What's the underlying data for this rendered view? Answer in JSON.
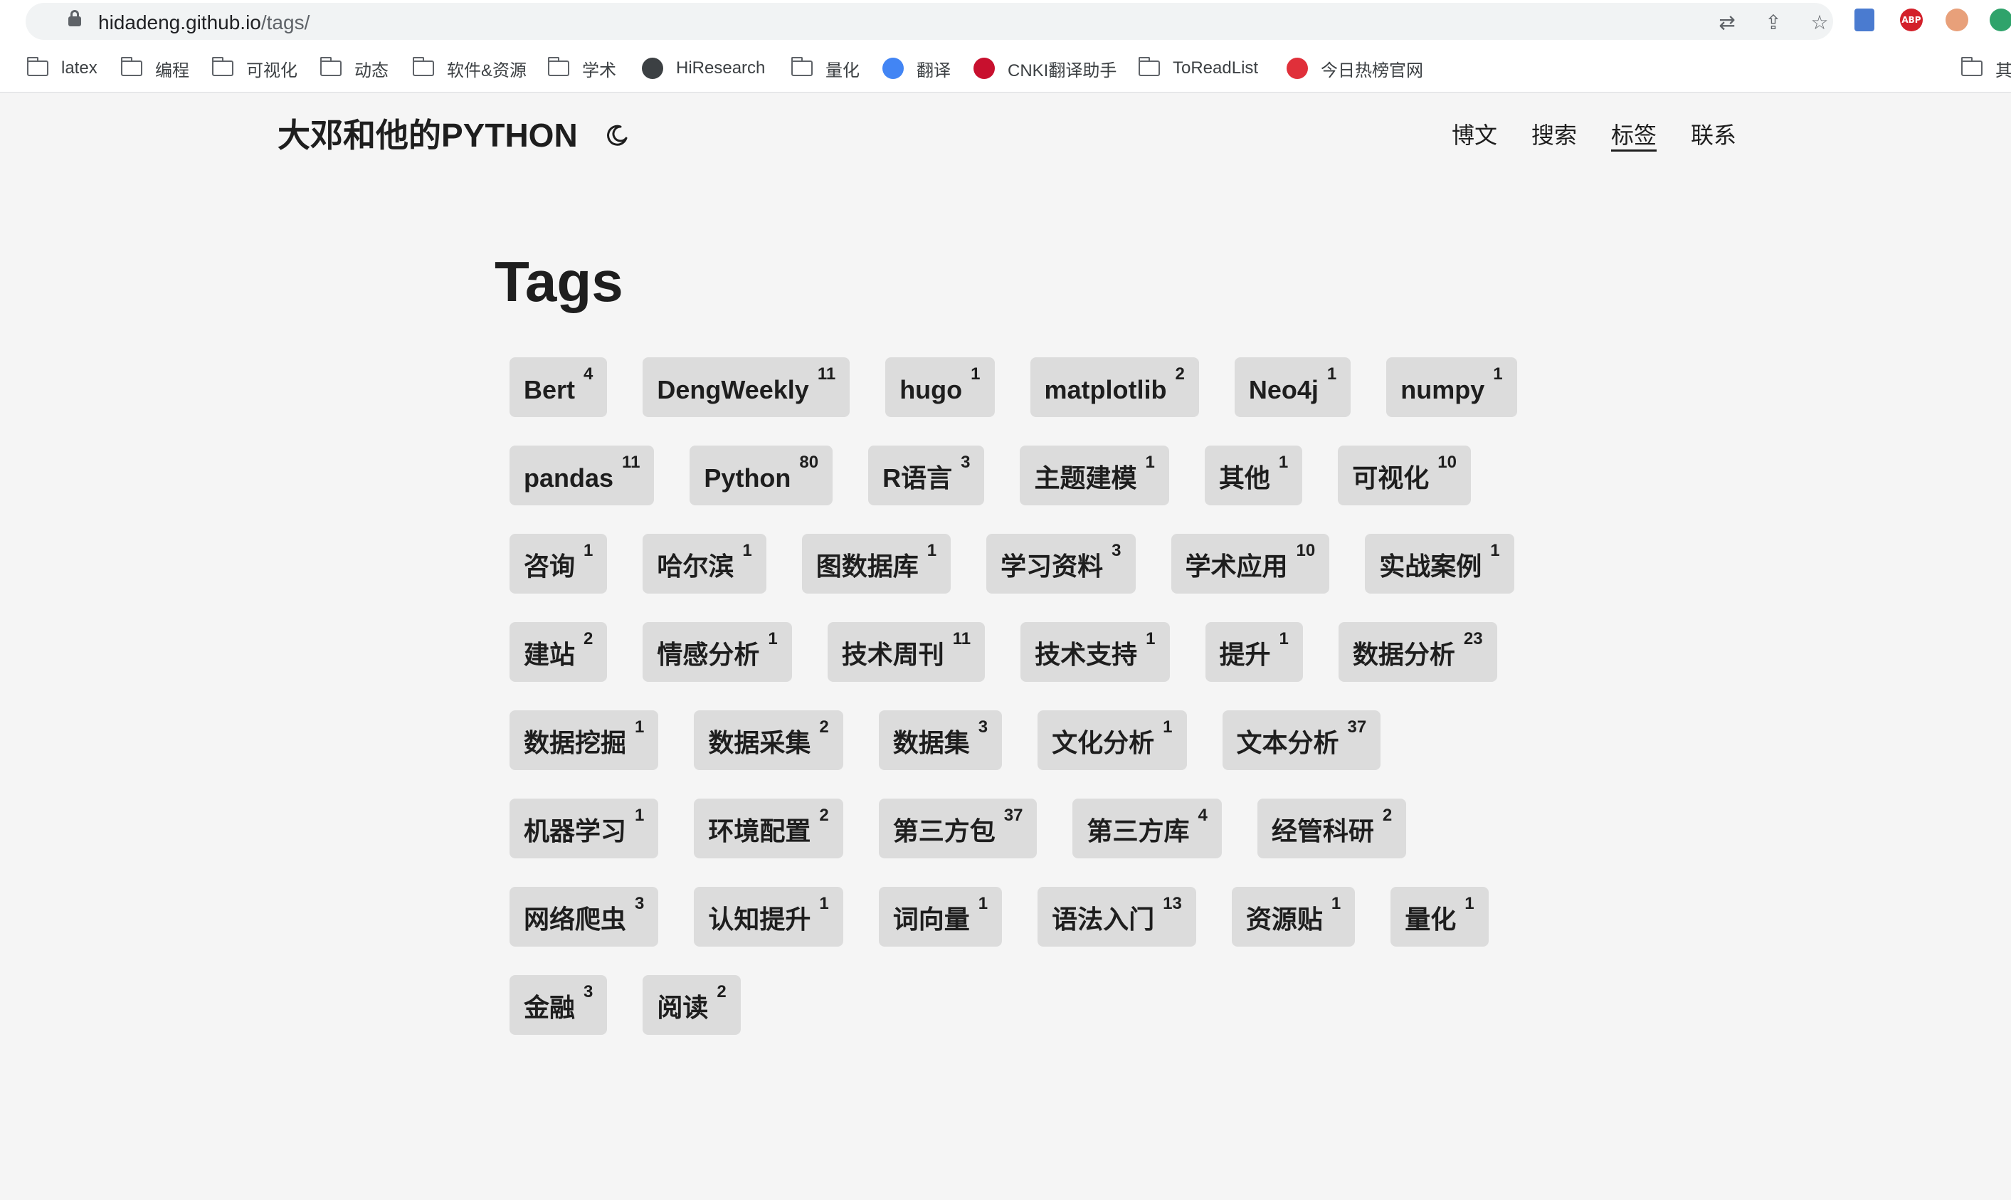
{
  "browser": {
    "url_host": "hidadeng.github.io",
    "url_path": "/tags/",
    "bookmarks": [
      {
        "label": "latex",
        "icon": "folder-icon"
      },
      {
        "label": "编程",
        "icon": "folder-icon"
      },
      {
        "label": "可视化",
        "icon": "folder-icon"
      },
      {
        "label": "动态",
        "icon": "folder-icon"
      },
      {
        "label": "软件&资源",
        "icon": "folder-icon"
      },
      {
        "label": "学术",
        "icon": "folder-icon"
      },
      {
        "label": "HiResearch",
        "icon": "globe-icon"
      },
      {
        "label": "量化",
        "icon": "folder-icon"
      },
      {
        "label": "翻译",
        "icon": "google-translate-icon"
      },
      {
        "label": "CNKI翻译助手",
        "icon": "cnki-icon"
      },
      {
        "label": "ToReadList",
        "icon": "folder-icon"
      },
      {
        "label": "今日热榜官网",
        "icon": "rebang-icon"
      },
      {
        "label": "其",
        "icon": "folder-icon"
      }
    ],
    "extensions": {
      "abp_label": "ABP"
    }
  },
  "site": {
    "title": "大邓和他的PYTHON",
    "nav": [
      {
        "label": "博文",
        "active": false
      },
      {
        "label": "搜索",
        "active": false
      },
      {
        "label": "标签",
        "active": true
      },
      {
        "label": "联系",
        "active": false
      }
    ]
  },
  "page": {
    "title": "Tags"
  },
  "tags": [
    {
      "name": "Bert",
      "count": "4"
    },
    {
      "name": "DengWeekly",
      "count": "11"
    },
    {
      "name": "hugo",
      "count": "1"
    },
    {
      "name": "matplotlib",
      "count": "2"
    },
    {
      "name": "Neo4j",
      "count": "1"
    },
    {
      "name": "numpy",
      "count": "1"
    },
    {
      "name": "pandas",
      "count": "11"
    },
    {
      "name": "Python",
      "count": "80"
    },
    {
      "name": "R语言",
      "count": "3"
    },
    {
      "name": "主题建模",
      "count": "1"
    },
    {
      "name": "其他",
      "count": "1"
    },
    {
      "name": "可视化",
      "count": "10"
    },
    {
      "name": "咨询",
      "count": "1"
    },
    {
      "name": "哈尔滨",
      "count": "1"
    },
    {
      "name": "图数据库",
      "count": "1"
    },
    {
      "name": "学习资料",
      "count": "3"
    },
    {
      "name": "学术应用",
      "count": "10"
    },
    {
      "name": "实战案例",
      "count": "1"
    },
    {
      "name": "建站",
      "count": "2"
    },
    {
      "name": "情感分析",
      "count": "1"
    },
    {
      "name": "技术周刊",
      "count": "11"
    },
    {
      "name": "技术支持",
      "count": "1"
    },
    {
      "name": "提升",
      "count": "1"
    },
    {
      "name": "数据分析",
      "count": "23"
    },
    {
      "name": "数据挖掘",
      "count": "1"
    },
    {
      "name": "数据采集",
      "count": "2"
    },
    {
      "name": "数据集",
      "count": "3"
    },
    {
      "name": "文化分析",
      "count": "1"
    },
    {
      "name": "文本分析",
      "count": "37"
    },
    {
      "name": "机器学习",
      "count": "1"
    },
    {
      "name": "环境配置",
      "count": "2"
    },
    {
      "name": "第三方包",
      "count": "37"
    },
    {
      "name": "第三方库",
      "count": "4"
    },
    {
      "name": "经管科研",
      "count": "2"
    },
    {
      "name": "网络爬虫",
      "count": "3"
    },
    {
      "name": "认知提升",
      "count": "1"
    },
    {
      "name": "词向量",
      "count": "1"
    },
    {
      "name": "语法入门",
      "count": "13"
    },
    {
      "name": "资源贴",
      "count": "1"
    },
    {
      "name": "量化",
      "count": "1"
    },
    {
      "name": "金融",
      "count": "3"
    },
    {
      "name": "阅读",
      "count": "2"
    }
  ]
}
